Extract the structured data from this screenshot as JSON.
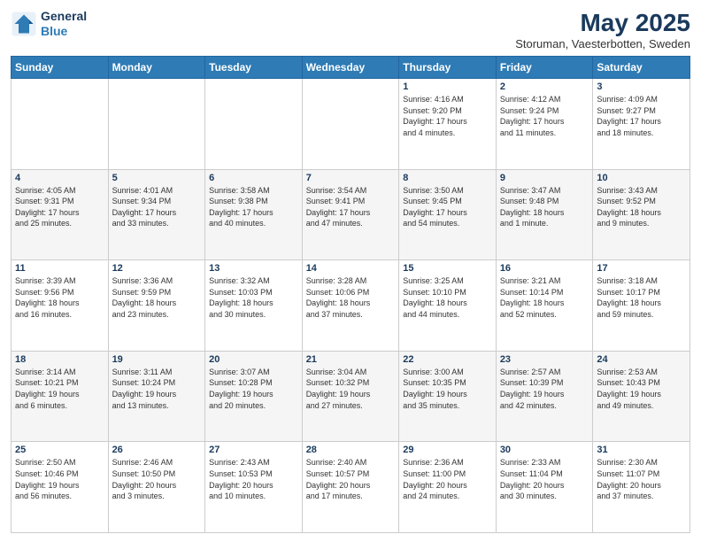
{
  "header": {
    "logo_line1": "General",
    "logo_line2": "Blue",
    "title": "May 2025",
    "subtitle": "Storuman, Vaesterbotten, Sweden"
  },
  "days_of_week": [
    "Sunday",
    "Monday",
    "Tuesday",
    "Wednesday",
    "Thursday",
    "Friday",
    "Saturday"
  ],
  "weeks": [
    [
      {
        "day": "",
        "info": ""
      },
      {
        "day": "",
        "info": ""
      },
      {
        "day": "",
        "info": ""
      },
      {
        "day": "",
        "info": ""
      },
      {
        "day": "1",
        "info": "Sunrise: 4:16 AM\nSunset: 9:20 PM\nDaylight: 17 hours\nand 4 minutes."
      },
      {
        "day": "2",
        "info": "Sunrise: 4:12 AM\nSunset: 9:24 PM\nDaylight: 17 hours\nand 11 minutes."
      },
      {
        "day": "3",
        "info": "Sunrise: 4:09 AM\nSunset: 9:27 PM\nDaylight: 17 hours\nand 18 minutes."
      }
    ],
    [
      {
        "day": "4",
        "info": "Sunrise: 4:05 AM\nSunset: 9:31 PM\nDaylight: 17 hours\nand 25 minutes."
      },
      {
        "day": "5",
        "info": "Sunrise: 4:01 AM\nSunset: 9:34 PM\nDaylight: 17 hours\nand 33 minutes."
      },
      {
        "day": "6",
        "info": "Sunrise: 3:58 AM\nSunset: 9:38 PM\nDaylight: 17 hours\nand 40 minutes."
      },
      {
        "day": "7",
        "info": "Sunrise: 3:54 AM\nSunset: 9:41 PM\nDaylight: 17 hours\nand 47 minutes."
      },
      {
        "day": "8",
        "info": "Sunrise: 3:50 AM\nSunset: 9:45 PM\nDaylight: 17 hours\nand 54 minutes."
      },
      {
        "day": "9",
        "info": "Sunrise: 3:47 AM\nSunset: 9:48 PM\nDaylight: 18 hours\nand 1 minute."
      },
      {
        "day": "10",
        "info": "Sunrise: 3:43 AM\nSunset: 9:52 PM\nDaylight: 18 hours\nand 9 minutes."
      }
    ],
    [
      {
        "day": "11",
        "info": "Sunrise: 3:39 AM\nSunset: 9:56 PM\nDaylight: 18 hours\nand 16 minutes."
      },
      {
        "day": "12",
        "info": "Sunrise: 3:36 AM\nSunset: 9:59 PM\nDaylight: 18 hours\nand 23 minutes."
      },
      {
        "day": "13",
        "info": "Sunrise: 3:32 AM\nSunset: 10:03 PM\nDaylight: 18 hours\nand 30 minutes."
      },
      {
        "day": "14",
        "info": "Sunrise: 3:28 AM\nSunset: 10:06 PM\nDaylight: 18 hours\nand 37 minutes."
      },
      {
        "day": "15",
        "info": "Sunrise: 3:25 AM\nSunset: 10:10 PM\nDaylight: 18 hours\nand 44 minutes."
      },
      {
        "day": "16",
        "info": "Sunrise: 3:21 AM\nSunset: 10:14 PM\nDaylight: 18 hours\nand 52 minutes."
      },
      {
        "day": "17",
        "info": "Sunrise: 3:18 AM\nSunset: 10:17 PM\nDaylight: 18 hours\nand 59 minutes."
      }
    ],
    [
      {
        "day": "18",
        "info": "Sunrise: 3:14 AM\nSunset: 10:21 PM\nDaylight: 19 hours\nand 6 minutes."
      },
      {
        "day": "19",
        "info": "Sunrise: 3:11 AM\nSunset: 10:24 PM\nDaylight: 19 hours\nand 13 minutes."
      },
      {
        "day": "20",
        "info": "Sunrise: 3:07 AM\nSunset: 10:28 PM\nDaylight: 19 hours\nand 20 minutes."
      },
      {
        "day": "21",
        "info": "Sunrise: 3:04 AM\nSunset: 10:32 PM\nDaylight: 19 hours\nand 27 minutes."
      },
      {
        "day": "22",
        "info": "Sunrise: 3:00 AM\nSunset: 10:35 PM\nDaylight: 19 hours\nand 35 minutes."
      },
      {
        "day": "23",
        "info": "Sunrise: 2:57 AM\nSunset: 10:39 PM\nDaylight: 19 hours\nand 42 minutes."
      },
      {
        "day": "24",
        "info": "Sunrise: 2:53 AM\nSunset: 10:43 PM\nDaylight: 19 hours\nand 49 minutes."
      }
    ],
    [
      {
        "day": "25",
        "info": "Sunrise: 2:50 AM\nSunset: 10:46 PM\nDaylight: 19 hours\nand 56 minutes."
      },
      {
        "day": "26",
        "info": "Sunrise: 2:46 AM\nSunset: 10:50 PM\nDaylight: 20 hours\nand 3 minutes."
      },
      {
        "day": "27",
        "info": "Sunrise: 2:43 AM\nSunset: 10:53 PM\nDaylight: 20 hours\nand 10 minutes."
      },
      {
        "day": "28",
        "info": "Sunrise: 2:40 AM\nSunset: 10:57 PM\nDaylight: 20 hours\nand 17 minutes."
      },
      {
        "day": "29",
        "info": "Sunrise: 2:36 AM\nSunset: 11:00 PM\nDaylight: 20 hours\nand 24 minutes."
      },
      {
        "day": "30",
        "info": "Sunrise: 2:33 AM\nSunset: 11:04 PM\nDaylight: 20 hours\nand 30 minutes."
      },
      {
        "day": "31",
        "info": "Sunrise: 2:30 AM\nSunset: 11:07 PM\nDaylight: 20 hours\nand 37 minutes."
      }
    ]
  ]
}
